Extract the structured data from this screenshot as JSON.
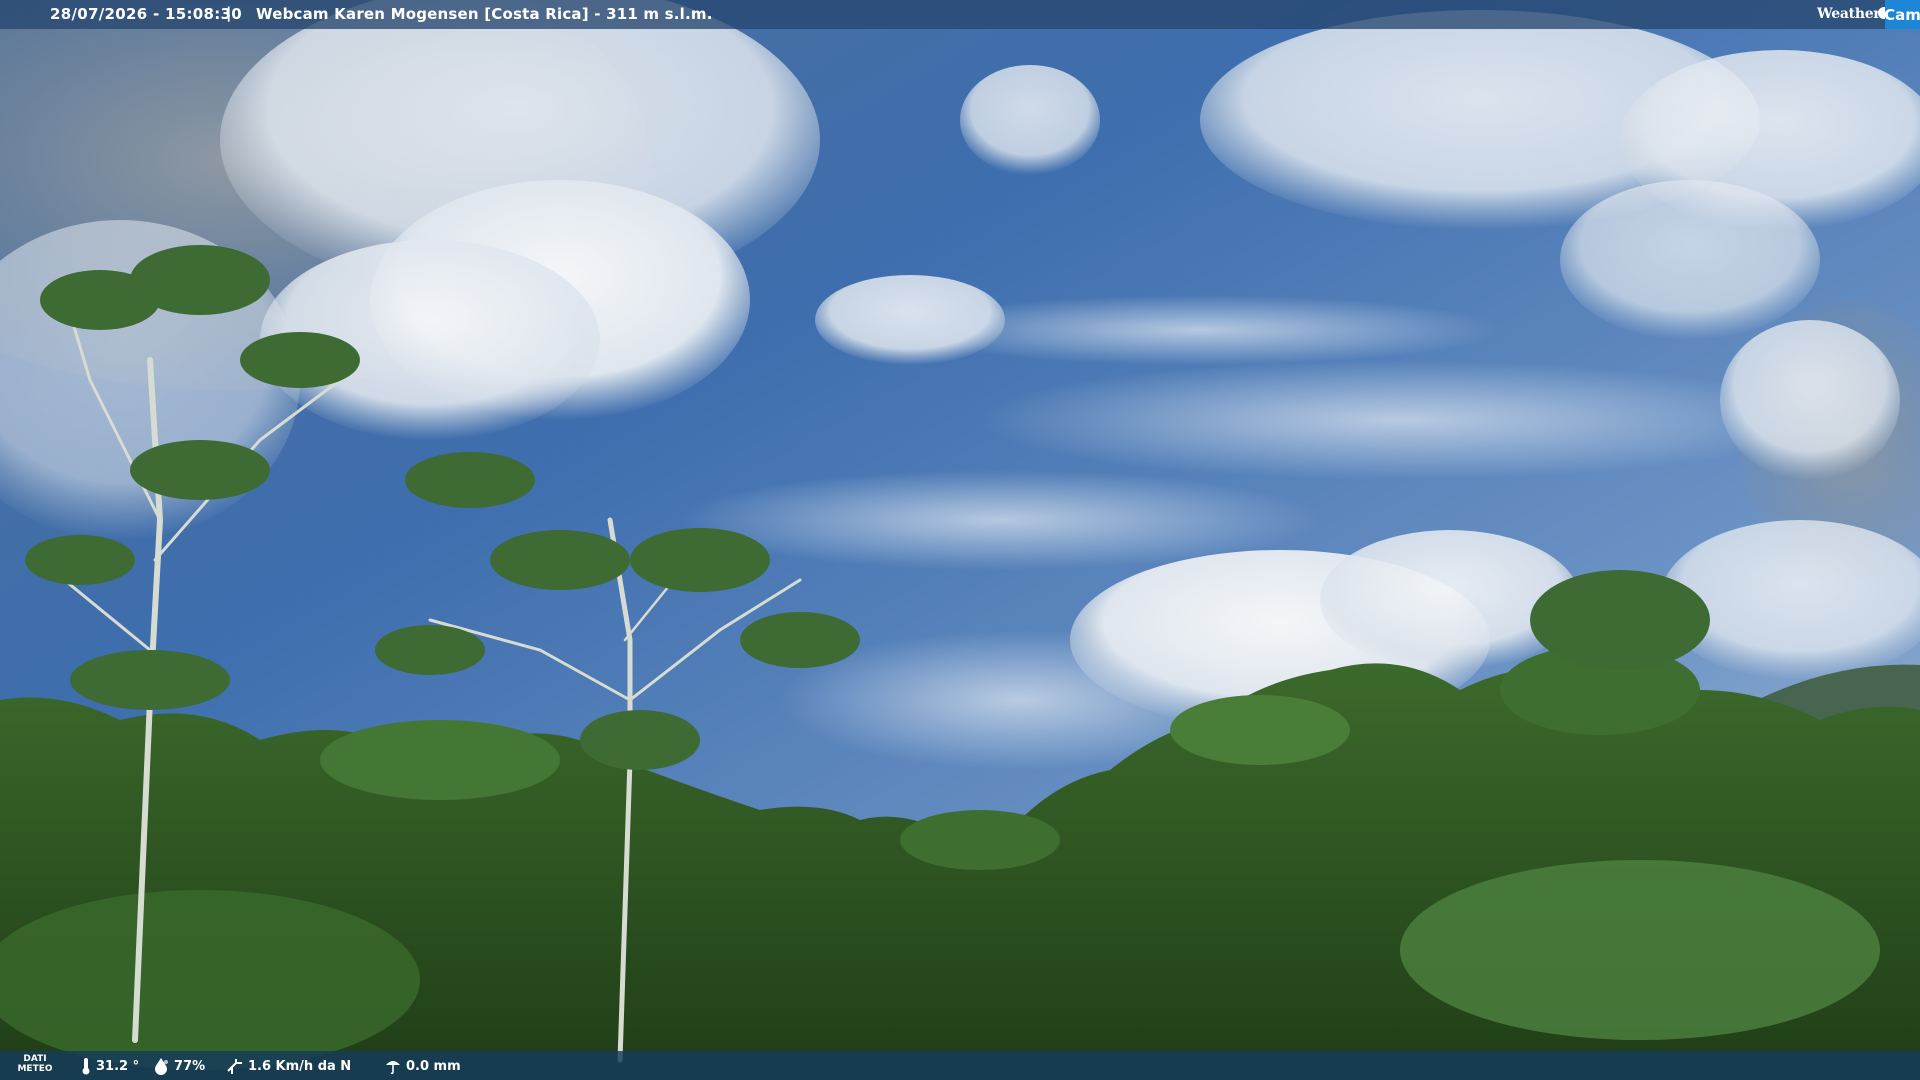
{
  "header": {
    "datetime": "28/07/2026 - 15:08:30",
    "separator": "|",
    "title": "Webcam Karen Mogensen [Costa Rica] - 311 m s.l.m."
  },
  "logo": {
    "weather": "Weather",
    "cam": "Cam",
    "brand_color": "#1d86d6"
  },
  "footer": {
    "label_line1": "DATI",
    "label_line2": "METEO",
    "temperature": "31.2 °",
    "humidity": "77%",
    "wind": "1.6 Km/h da N",
    "rain": "0.0 mm",
    "icons": [
      "thermometer-icon",
      "humidity-icon",
      "wind-icon",
      "rain-icon"
    ]
  },
  "scene": {
    "sky_color": "#3f6fae",
    "cloud_color": "#e6ecf2",
    "foliage_color": "#2f5a22"
  }
}
